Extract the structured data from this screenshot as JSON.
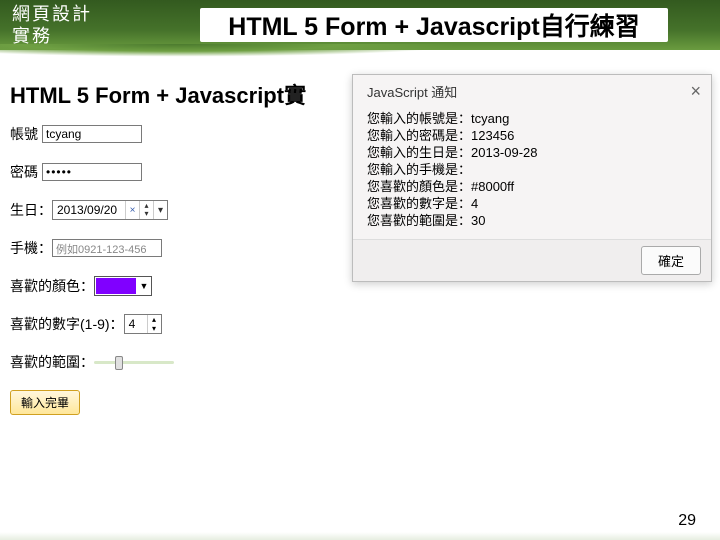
{
  "header": {
    "logo_line1": "網頁設計",
    "logo_line2": "實務",
    "title": "HTML 5 Form + Javascript自行練習"
  },
  "form": {
    "title": "HTML 5 Form + Javascript實",
    "account_label": "帳號",
    "account_value": "tcyang",
    "password_label": "密碼",
    "password_value": "•••••",
    "birthday_label": "生日：",
    "birthday_value": "2013/09/20",
    "phone_label": "手機：",
    "phone_placeholder": "例如0921-123-456",
    "color_label": "喜歡的顏色：",
    "color_value": "#8000ff",
    "number_label": "喜歡的數字(1-9)：",
    "number_value": "4",
    "range_label": "喜歡的範圍：",
    "range_value": 30,
    "submit_label": "輸入完畢"
  },
  "dialog": {
    "title": "JavaScript 通知",
    "lines": [
      "您輸入的帳號是：tcyang",
      "您輸入的密碼是：123456",
      "您輸入的生日是：2013-09-28",
      "您輸入的手機是：",
      "您喜歡的顏色是：#8000ff",
      "您喜歡的數字是：4",
      "您喜歡的範圍是：30"
    ],
    "ok": "確定"
  },
  "page_number": "29"
}
